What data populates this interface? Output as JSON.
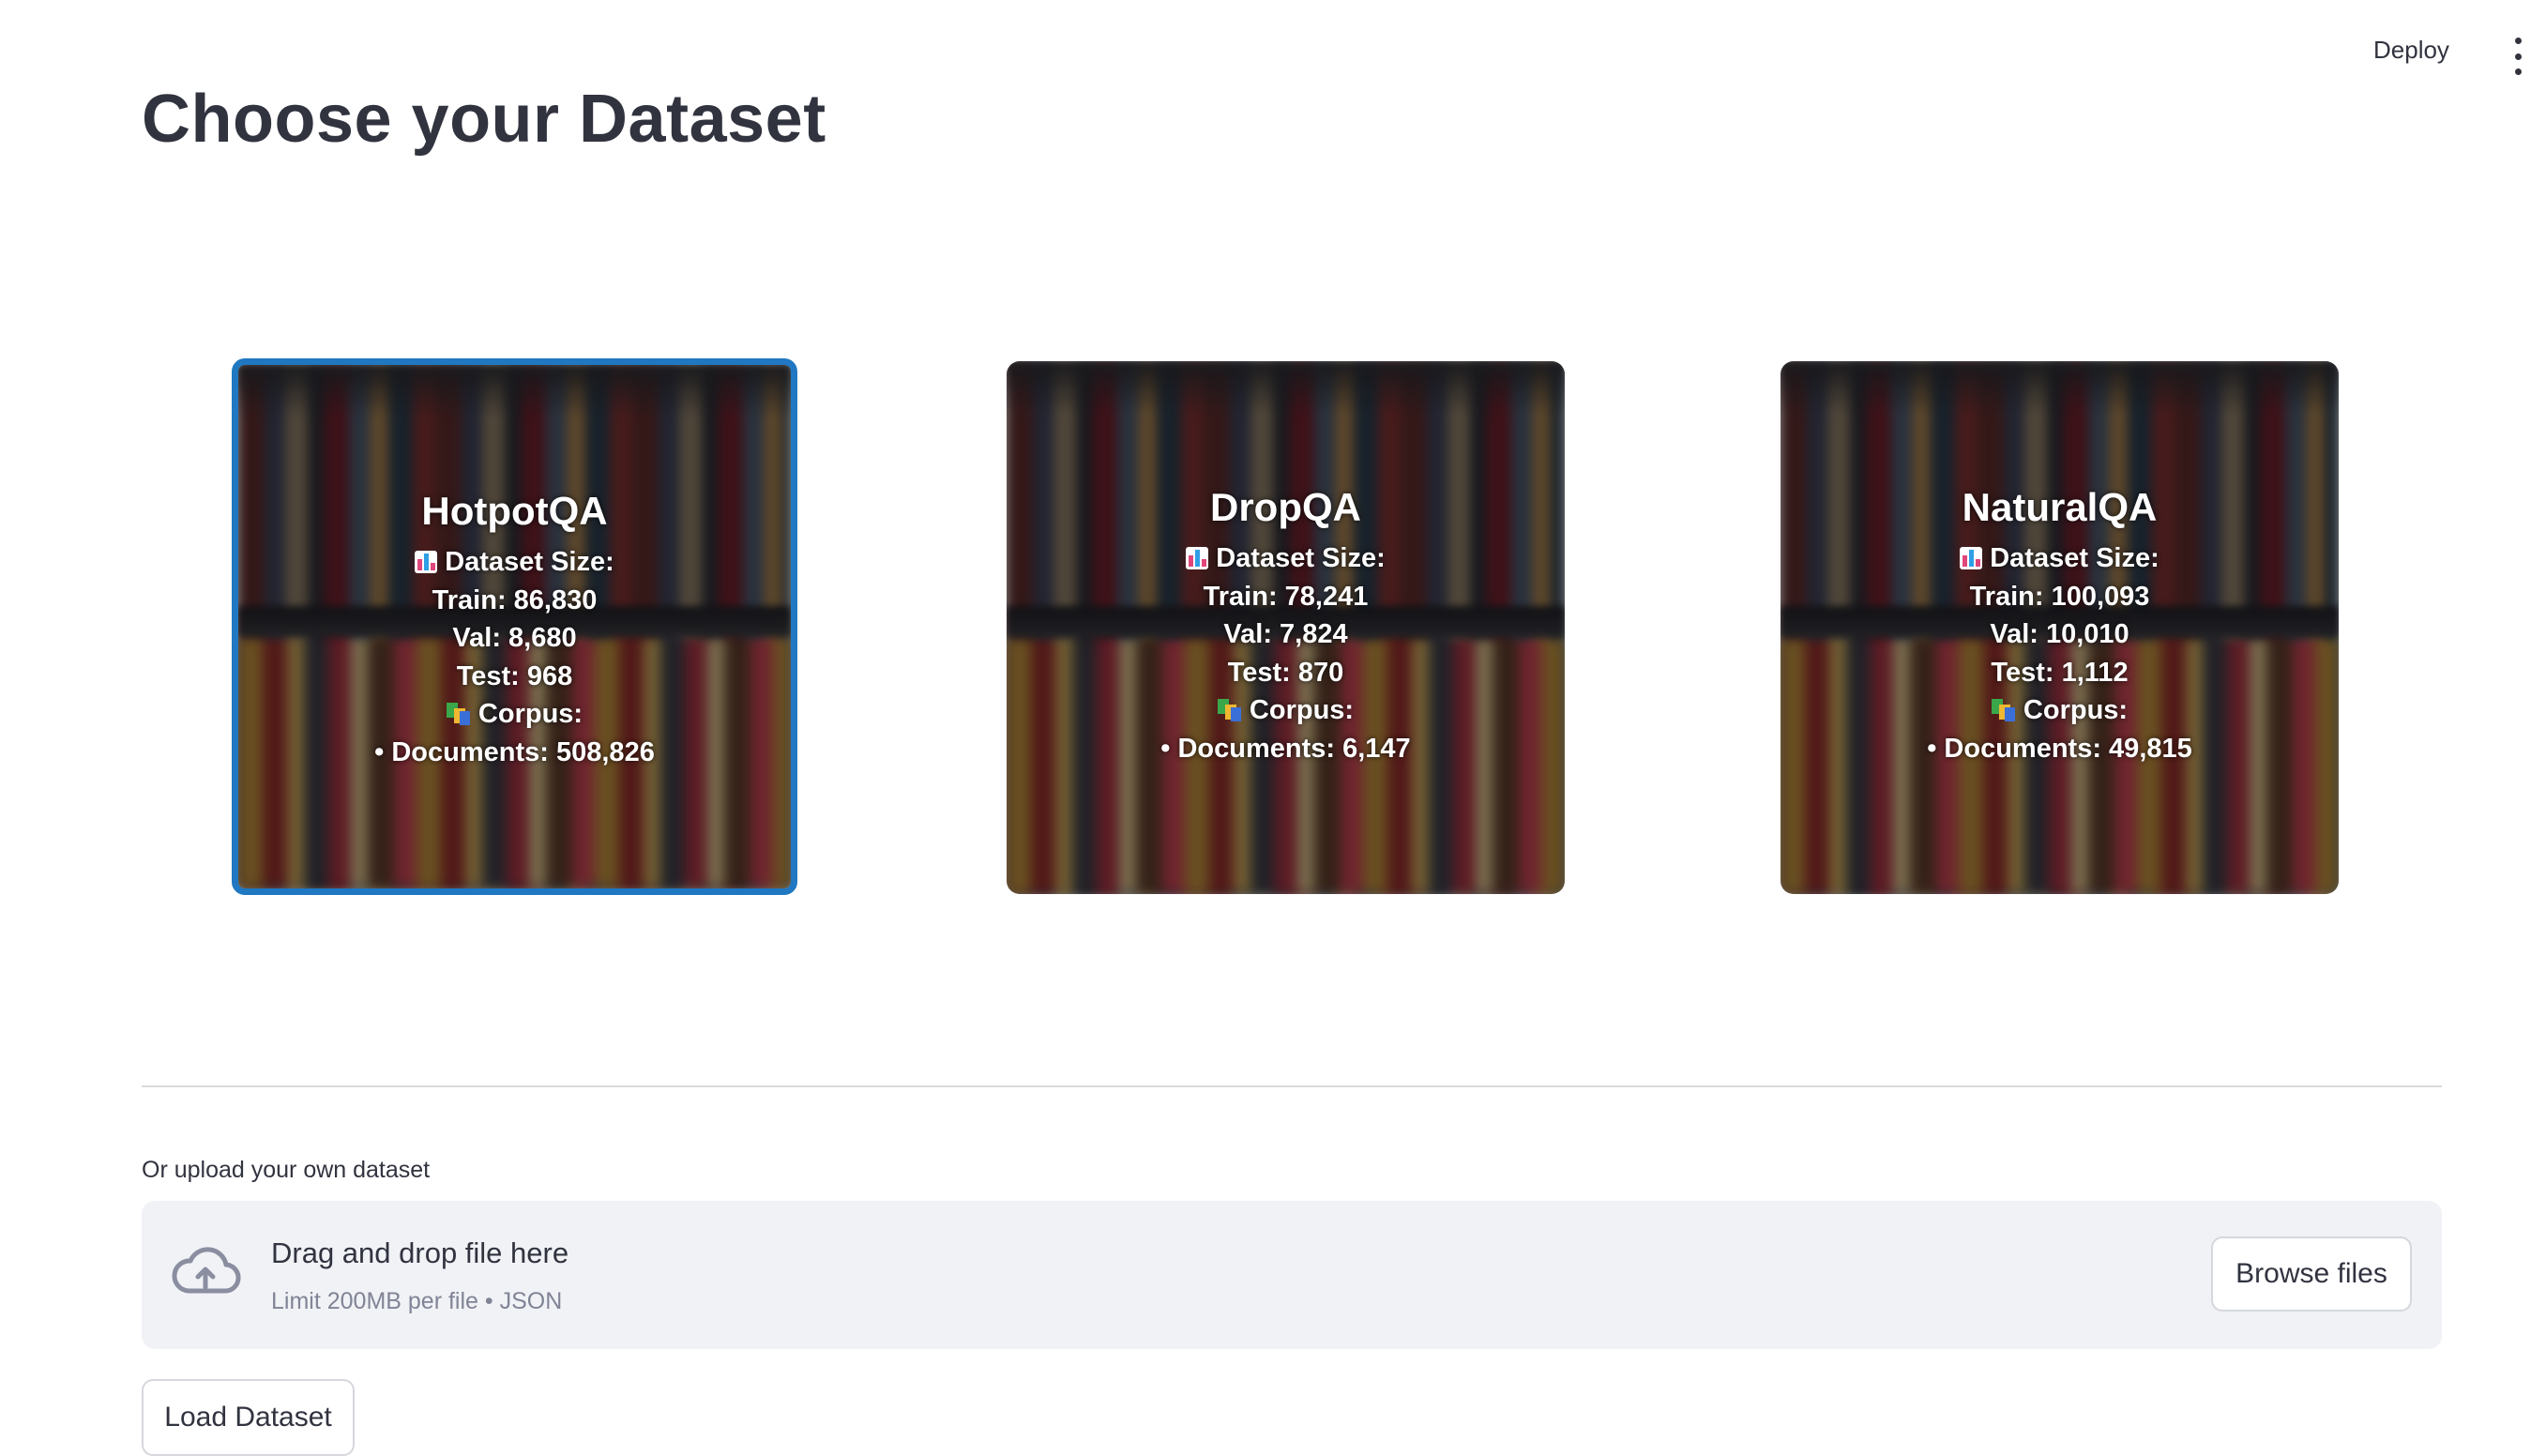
{
  "header": {
    "deploy_label": "Deploy",
    "menu_icon": "more-vertical-icon"
  },
  "page": {
    "title": "Choose your Dataset"
  },
  "datasets": [
    {
      "name": "HotpotQA",
      "selected": true,
      "size_label": "Dataset Size:",
      "train": "Train: 86,830",
      "val": "Val: 8,680",
      "test": "Test: 968",
      "corpus_label": "Corpus:",
      "documents": "• Documents: 508,826"
    },
    {
      "name": "DropQA",
      "selected": false,
      "size_label": "Dataset Size:",
      "train": "Train: 78,241",
      "val": "Val: 7,824",
      "test": "Test: 870",
      "corpus_label": "Corpus:",
      "documents": "• Documents: 6,147"
    },
    {
      "name": "NaturalQA",
      "selected": false,
      "size_label": "Dataset Size:",
      "train": "Train: 100,093",
      "val": "Val: 10,010",
      "test": "Test: 1,112",
      "corpus_label": "Corpus:",
      "documents": "• Documents: 49,815"
    }
  ],
  "upload": {
    "label": "Or upload your own dataset",
    "drag_text": "Drag and drop file here",
    "limit_text": "Limit 200MB per file • JSON",
    "browse_label": "Browse files",
    "icon": "cloud-upload-icon"
  },
  "actions": {
    "load_label": "Load Dataset"
  },
  "colors": {
    "selected_border": "#1f78c1",
    "dropzone_bg": "#f0f2f6",
    "text": "#31333f",
    "muted_text": "#808495"
  }
}
